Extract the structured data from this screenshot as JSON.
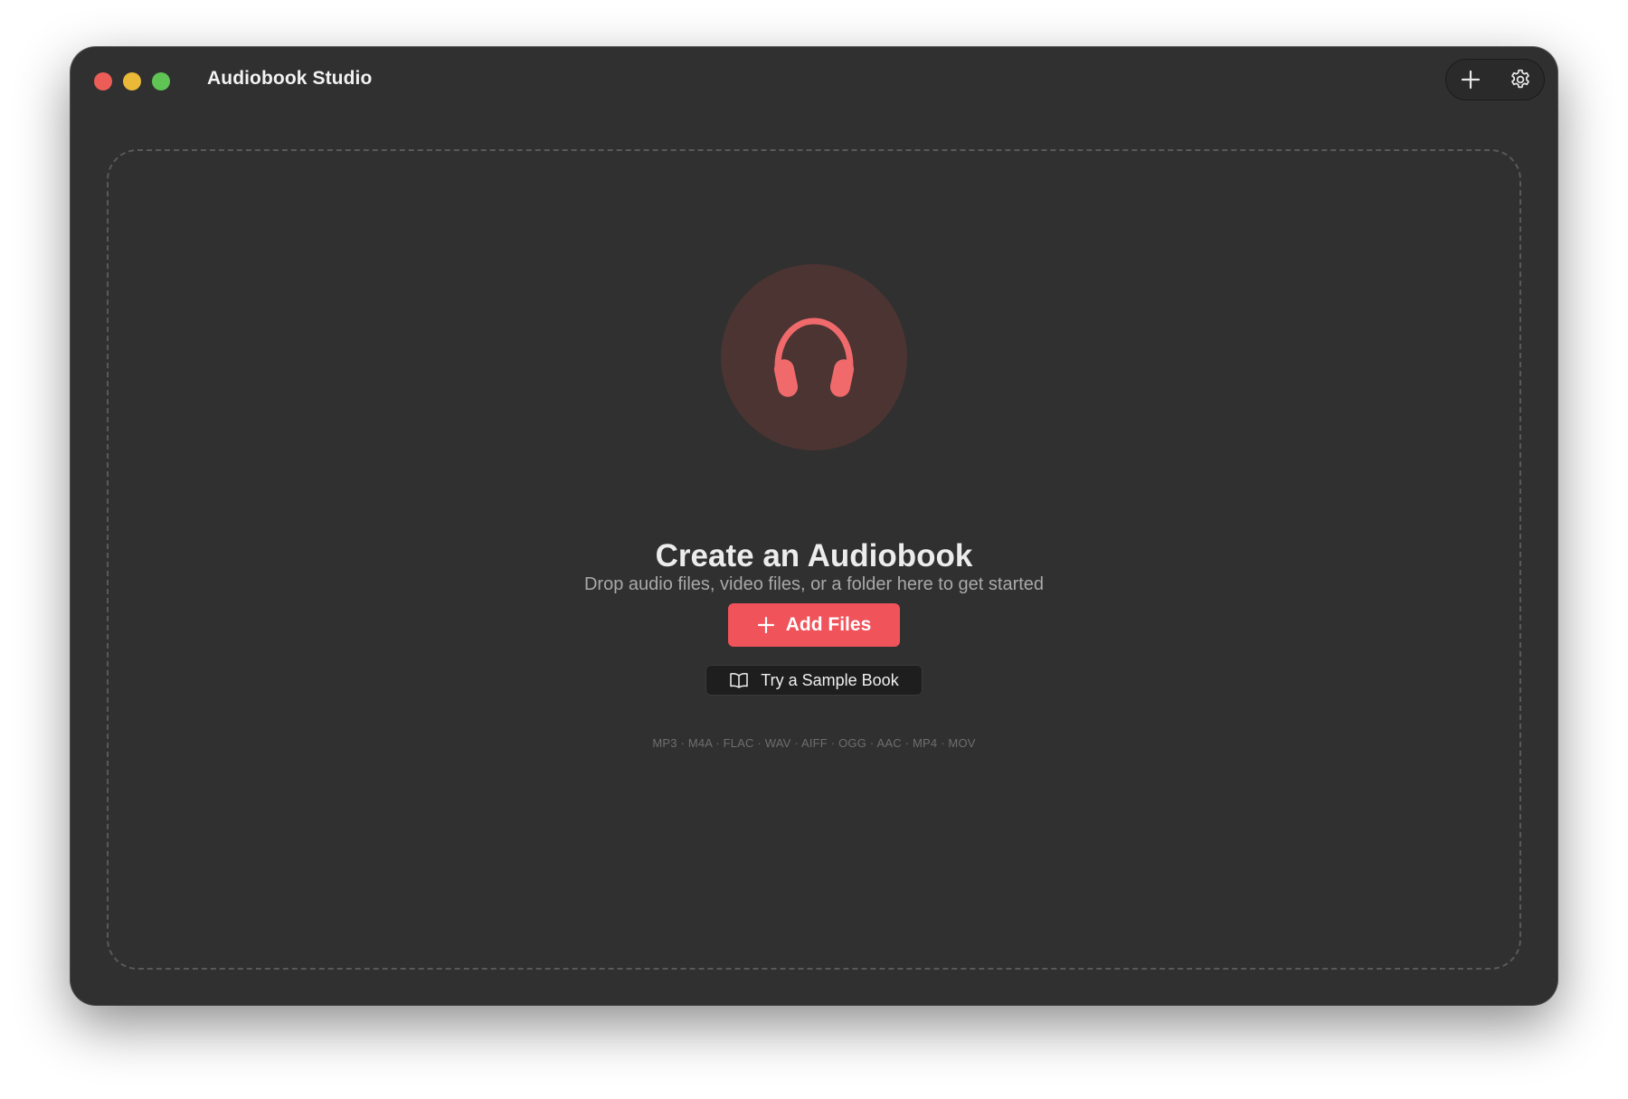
{
  "window": {
    "title": "Audiobook Studio"
  },
  "toolbar": {
    "add_icon": "plus-icon",
    "settings_icon": "gear-icon"
  },
  "dropzone": {
    "hero_icon": "headphones-icon",
    "headline": "Create an Audiobook",
    "subtitle": "Drop audio files, video files, or a folder here to get started",
    "primary_button": {
      "label": "Add Files",
      "icon": "plus-icon"
    },
    "secondary_button": {
      "label": "Try a Sample Book",
      "icon": "book-icon"
    },
    "formats_text": "MP3 · M4A · FLAC · WAV · AIFF · OGG · AAC · MP4 · MOV"
  },
  "colors": {
    "accent": "#f0535a",
    "window_bg": "#303030",
    "hero_circle": "#4b3432",
    "icon": "#f06a6c"
  }
}
